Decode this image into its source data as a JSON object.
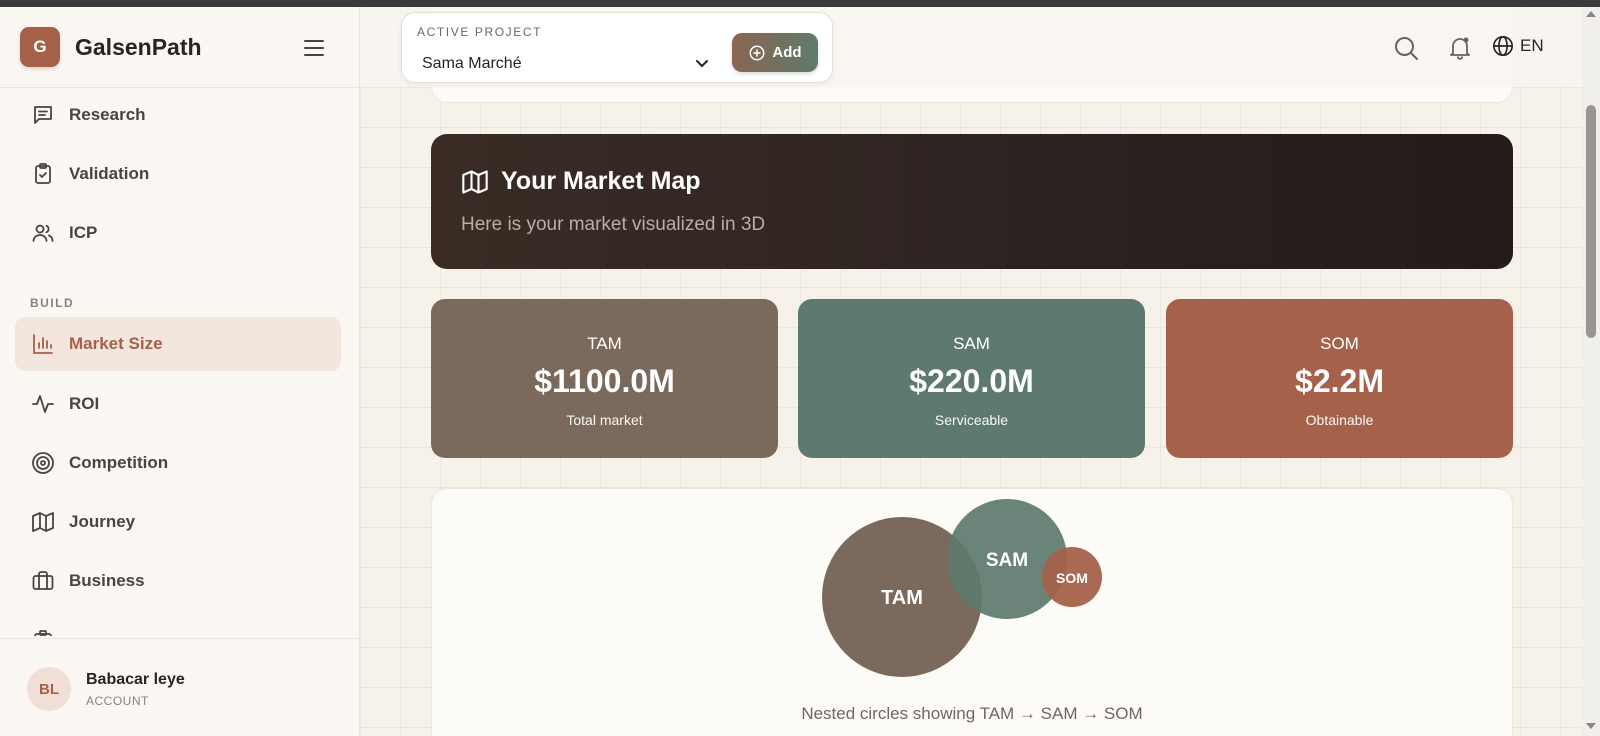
{
  "app": {
    "logo_letter": "G",
    "name": "GalsenPath"
  },
  "sidebar": {
    "items_top": [
      {
        "label": "Research",
        "icon": "message-square-icon"
      },
      {
        "label": "Validation",
        "icon": "clipboard-check-icon"
      },
      {
        "label": "ICP",
        "icon": "users-icon"
      }
    ],
    "section_build": "BUILD",
    "items_build": [
      {
        "label": "Market Size",
        "icon": "bar-chart-icon",
        "active": true
      },
      {
        "label": "ROI",
        "icon": "activity-icon"
      },
      {
        "label": "Competition",
        "icon": "target-icon"
      },
      {
        "label": "Journey",
        "icon": "map-icon"
      },
      {
        "label": "Business",
        "icon": "briefcase-icon"
      }
    ]
  },
  "user": {
    "initials": "BL",
    "name": "Babacar leye",
    "role": "ACCOUNT"
  },
  "header": {
    "project_label": "ACTIVE PROJECT",
    "project_name": "Sama Marché",
    "add_label": "Add",
    "language": "EN"
  },
  "market_map": {
    "title": "Your Market Map",
    "subtitle": "Here is your market visualized in 3D"
  },
  "stats": [
    {
      "label": "TAM",
      "value": "$1100.0M",
      "desc": "Total market",
      "color": "#7b6a5c"
    },
    {
      "label": "SAM",
      "value": "$220.0M",
      "desc": "Serviceable",
      "color": "#5e7a6f"
    },
    {
      "label": "SOM",
      "value": "$2.2M",
      "desc": "Obtainable",
      "color": "#a5614a"
    }
  ],
  "visualization": {
    "circles": [
      {
        "label": "TAM",
        "color": "#7b6a5c"
      },
      {
        "label": "SAM",
        "color": "#5e7a6f"
      },
      {
        "label": "SOM",
        "color": "#a5614a"
      }
    ],
    "caption": "Nested circles showing TAM → SAM → SOM"
  },
  "colors": {
    "accent": "#a5614a",
    "active_bg": "#f3e6df",
    "banner_dark": "#2b2220"
  }
}
